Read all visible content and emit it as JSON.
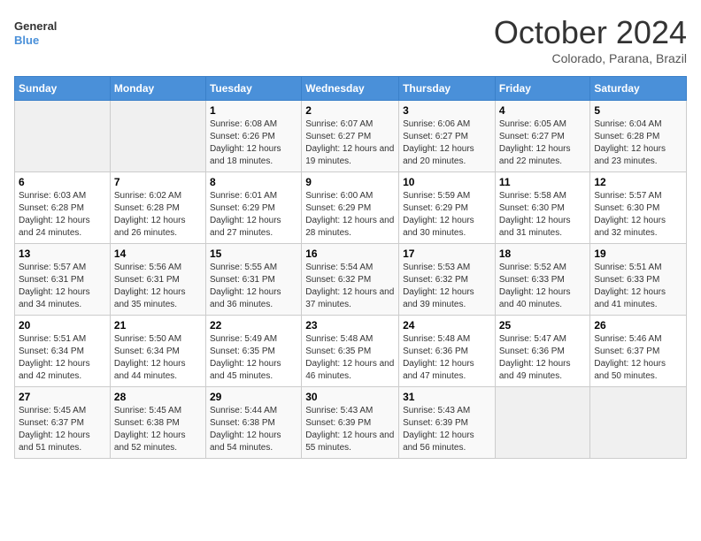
{
  "header": {
    "logo_line1": "General",
    "logo_line2": "Blue",
    "month": "October 2024",
    "location": "Colorado, Parana, Brazil"
  },
  "days_of_week": [
    "Sunday",
    "Monday",
    "Tuesday",
    "Wednesday",
    "Thursday",
    "Friday",
    "Saturday"
  ],
  "weeks": [
    [
      {
        "day": "",
        "info": ""
      },
      {
        "day": "",
        "info": ""
      },
      {
        "day": "1",
        "info": "Sunrise: 6:08 AM\nSunset: 6:26 PM\nDaylight: 12 hours and 18 minutes."
      },
      {
        "day": "2",
        "info": "Sunrise: 6:07 AM\nSunset: 6:27 PM\nDaylight: 12 hours and 19 minutes."
      },
      {
        "day": "3",
        "info": "Sunrise: 6:06 AM\nSunset: 6:27 PM\nDaylight: 12 hours and 20 minutes."
      },
      {
        "day": "4",
        "info": "Sunrise: 6:05 AM\nSunset: 6:27 PM\nDaylight: 12 hours and 22 minutes."
      },
      {
        "day": "5",
        "info": "Sunrise: 6:04 AM\nSunset: 6:28 PM\nDaylight: 12 hours and 23 minutes."
      }
    ],
    [
      {
        "day": "6",
        "info": "Sunrise: 6:03 AM\nSunset: 6:28 PM\nDaylight: 12 hours and 24 minutes."
      },
      {
        "day": "7",
        "info": "Sunrise: 6:02 AM\nSunset: 6:28 PM\nDaylight: 12 hours and 26 minutes."
      },
      {
        "day": "8",
        "info": "Sunrise: 6:01 AM\nSunset: 6:29 PM\nDaylight: 12 hours and 27 minutes."
      },
      {
        "day": "9",
        "info": "Sunrise: 6:00 AM\nSunset: 6:29 PM\nDaylight: 12 hours and 28 minutes."
      },
      {
        "day": "10",
        "info": "Sunrise: 5:59 AM\nSunset: 6:29 PM\nDaylight: 12 hours and 30 minutes."
      },
      {
        "day": "11",
        "info": "Sunrise: 5:58 AM\nSunset: 6:30 PM\nDaylight: 12 hours and 31 minutes."
      },
      {
        "day": "12",
        "info": "Sunrise: 5:57 AM\nSunset: 6:30 PM\nDaylight: 12 hours and 32 minutes."
      }
    ],
    [
      {
        "day": "13",
        "info": "Sunrise: 5:57 AM\nSunset: 6:31 PM\nDaylight: 12 hours and 34 minutes."
      },
      {
        "day": "14",
        "info": "Sunrise: 5:56 AM\nSunset: 6:31 PM\nDaylight: 12 hours and 35 minutes."
      },
      {
        "day": "15",
        "info": "Sunrise: 5:55 AM\nSunset: 6:31 PM\nDaylight: 12 hours and 36 minutes."
      },
      {
        "day": "16",
        "info": "Sunrise: 5:54 AM\nSunset: 6:32 PM\nDaylight: 12 hours and 37 minutes."
      },
      {
        "day": "17",
        "info": "Sunrise: 5:53 AM\nSunset: 6:32 PM\nDaylight: 12 hours and 39 minutes."
      },
      {
        "day": "18",
        "info": "Sunrise: 5:52 AM\nSunset: 6:33 PM\nDaylight: 12 hours and 40 minutes."
      },
      {
        "day": "19",
        "info": "Sunrise: 5:51 AM\nSunset: 6:33 PM\nDaylight: 12 hours and 41 minutes."
      }
    ],
    [
      {
        "day": "20",
        "info": "Sunrise: 5:51 AM\nSunset: 6:34 PM\nDaylight: 12 hours and 42 minutes."
      },
      {
        "day": "21",
        "info": "Sunrise: 5:50 AM\nSunset: 6:34 PM\nDaylight: 12 hours and 44 minutes."
      },
      {
        "day": "22",
        "info": "Sunrise: 5:49 AM\nSunset: 6:35 PM\nDaylight: 12 hours and 45 minutes."
      },
      {
        "day": "23",
        "info": "Sunrise: 5:48 AM\nSunset: 6:35 PM\nDaylight: 12 hours and 46 minutes."
      },
      {
        "day": "24",
        "info": "Sunrise: 5:48 AM\nSunset: 6:36 PM\nDaylight: 12 hours and 47 minutes."
      },
      {
        "day": "25",
        "info": "Sunrise: 5:47 AM\nSunset: 6:36 PM\nDaylight: 12 hours and 49 minutes."
      },
      {
        "day": "26",
        "info": "Sunrise: 5:46 AM\nSunset: 6:37 PM\nDaylight: 12 hours and 50 minutes."
      }
    ],
    [
      {
        "day": "27",
        "info": "Sunrise: 5:45 AM\nSunset: 6:37 PM\nDaylight: 12 hours and 51 minutes."
      },
      {
        "day": "28",
        "info": "Sunrise: 5:45 AM\nSunset: 6:38 PM\nDaylight: 12 hours and 52 minutes."
      },
      {
        "day": "29",
        "info": "Sunrise: 5:44 AM\nSunset: 6:38 PM\nDaylight: 12 hours and 54 minutes."
      },
      {
        "day": "30",
        "info": "Sunrise: 5:43 AM\nSunset: 6:39 PM\nDaylight: 12 hours and 55 minutes."
      },
      {
        "day": "31",
        "info": "Sunrise: 5:43 AM\nSunset: 6:39 PM\nDaylight: 12 hours and 56 minutes."
      },
      {
        "day": "",
        "info": ""
      },
      {
        "day": "",
        "info": ""
      }
    ]
  ]
}
